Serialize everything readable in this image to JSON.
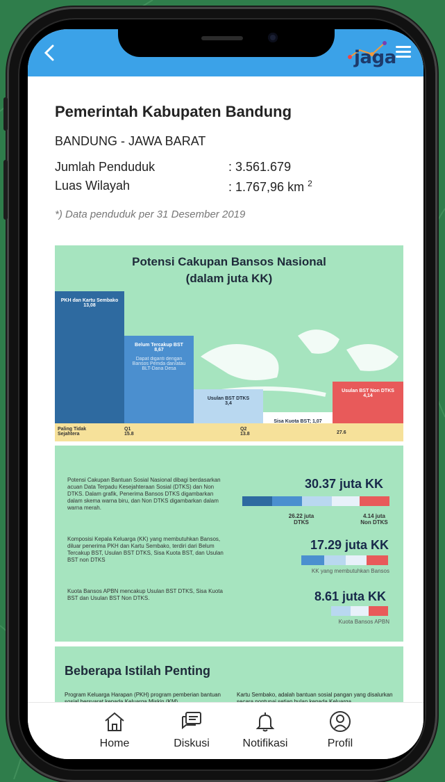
{
  "header": {
    "logo_text": "jaga"
  },
  "region": {
    "title": "Pemerintah Kabupaten Bandung",
    "province": "BANDUNG - JAWA BARAT",
    "population_label": "Jumlah Penduduk",
    "population_value": ": 3.561.679",
    "area_label": "Luas Wilayah",
    "area_value": ": 1.767,96 km",
    "area_unit_sup": "2",
    "note": "*) Data penduduk per 31 Desember 2019"
  },
  "infographic1": {
    "title_line1": "Potensi Cakupan Bansos Nasional",
    "title_line2": "(dalam juta KK)",
    "bars": [
      {
        "label": "PKH dan Kartu Sembako",
        "value_text": "13,08",
        "value": 13.08,
        "color": "#2e6aa0"
      },
      {
        "label": "Belum Tercakup BST",
        "value_text": "8,67",
        "value": 8.67,
        "color": "#4b8fcf",
        "sub": "Dapat diganti dengan Bansos Pemda dan/atau BLT-Dana Desa"
      },
      {
        "label": "Usulan BST DTKS",
        "value_text": "3,4",
        "value": 3.4,
        "color": "#b9d8f0"
      },
      {
        "label": "Sisa Kuota BST; 1,07",
        "value_text": "",
        "value": 1.07,
        "color": "#ffffff"
      },
      {
        "label": "Usulan BST Non DTKS",
        "value_text": "4,14",
        "value": 4.14,
        "color": "#e85a5a"
      }
    ],
    "axis_left": "Paling Tidak Sejahtera",
    "axis_q1": "Q1 15.8",
    "axis_q2": "Q2 13.8",
    "axis_end": "27.6"
  },
  "infographic2": {
    "para1": "Potensi Cakupan Bantuan Sosial Nasional dibagi berdasarkan acuan Data Terpadu Kesejahteraan Sosial (DTKS) dan Non DTKS. Dalam grafik, Penerima Bansos DTKS digambarkan dalam skema warna biru, dan Non DTKS digambarkan dalam warna merah.",
    "para2": "Komposisi Kepala Keluarga (KK) yang membutuhkan Bansos, diluar penerima PKH dan Kartu Sembako, terdiri dari Belum Tercakup BST, Usulan BST DTKS, Sisa Kuota BST, dan Usulan BST non DTKS",
    "para3": "Kuota Bansos APBN mencakup Usulan BST DTKS, Sisa Kuota BST dan Usulan BST Non DTKS.",
    "total1": "30.37 juta KK",
    "dtks_value": "26.22 juta",
    "dtks_label": "DTKS",
    "nondtks_value": "4.14 juta",
    "nondtks_label": "Non DTKS",
    "total2": "17.29 juta KK",
    "total2_note": "KK yang membutuhkan Bansos",
    "total3": "8.61 juta KK",
    "total3_note": "Kuota Bansos APBN"
  },
  "terms": {
    "title": "Beberapa Istilah Penting",
    "def1": "Program Keluarga Harapan (PKH) program pemberian bantuan sosial bersyarat kepada Keluarga Miskin (KM)",
    "def2": "Kartu Sembako, adalah bantuan sosial pangan yang disalurkan secara nontunai setiap bulan kepada Keluarga"
  },
  "bottom_nav": [
    {
      "label": "Home",
      "icon": "home-icon"
    },
    {
      "label": "Diskusi",
      "icon": "chat-icon"
    },
    {
      "label": "Notifikasi",
      "icon": "bell-icon"
    },
    {
      "label": "Profil",
      "icon": "profile-icon"
    }
  ],
  "colors": {
    "header": "#3ba2e8",
    "panel": "#a6e4bf",
    "background": "#2f7d4b"
  }
}
